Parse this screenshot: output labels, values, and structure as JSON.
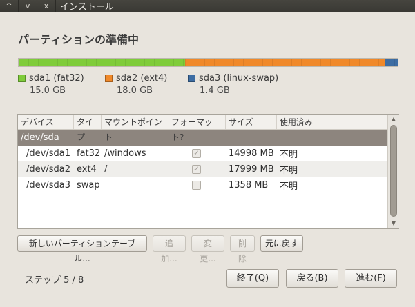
{
  "window": {
    "title": "インストール",
    "buttons": [
      "^",
      "v",
      "x"
    ]
  },
  "page_title": "パーティションの準備中",
  "partition_bar": [
    {
      "name": "sda1 (fat32)",
      "size": "15.0 GB",
      "color": "#7fcc3a",
      "fraction": 0.439
    },
    {
      "name": "sda2 (ext4)",
      "size": "18.0 GB",
      "color": "#f0892a",
      "fraction": 0.527
    },
    {
      "name": "sda3 (linux-swap)",
      "size": "1.4 GB",
      "color": "#3d6da3",
      "fraction": 0.034
    }
  ],
  "table": {
    "headers": [
      "デバイス",
      "タイプ",
      "マウントポイント",
      "フォーマット?",
      "サイズ",
      "使用済み"
    ],
    "group_row": "/dev/sda",
    "rows": [
      {
        "device": "/dev/sda1",
        "type": "fat32",
        "mount": "/windows",
        "format": true,
        "size": "14998 MB",
        "used": "不明"
      },
      {
        "device": "/dev/sda2",
        "type": "ext4",
        "mount": "/",
        "format": true,
        "size": "17999 MB",
        "used": "不明"
      },
      {
        "device": "/dev/sda3",
        "type": "swap",
        "mount": "",
        "format": false,
        "size": "1358 MB",
        "used": "不明"
      }
    ]
  },
  "actions": {
    "new_table": "新しいパーティションテーブル...",
    "add": "追加...",
    "change": "変更...",
    "delete": "削除",
    "revert": "元に戻す"
  },
  "footer": {
    "step": "ステップ 5 / 8",
    "quit": "終了(Q)",
    "back": "戻る(B)",
    "forward": "進む(F)"
  }
}
